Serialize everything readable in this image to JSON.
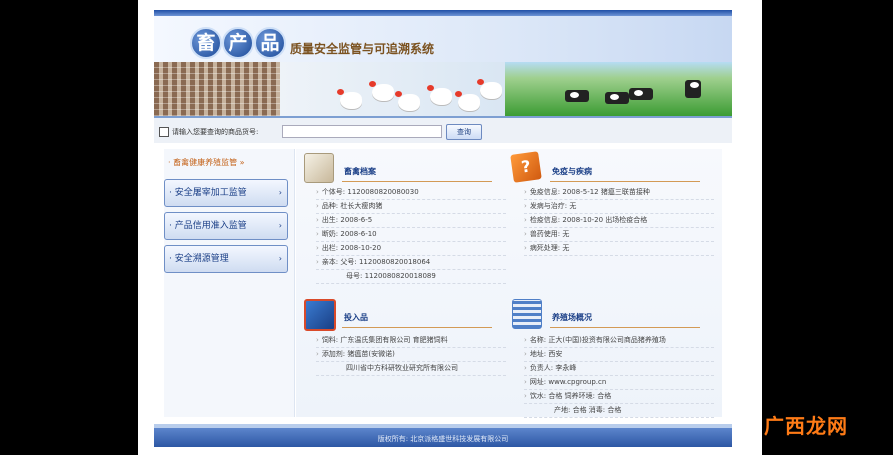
{
  "header": {
    "logo_chars": [
      "畜",
      "产",
      "品"
    ],
    "subtitle": "质量安全监管与可追溯系统"
  },
  "search": {
    "label": "请输入您要查询的商品货号:",
    "value": "",
    "button": "查询"
  },
  "sidebar": {
    "active": "· 畜禽健康养殖监管 »",
    "items": [
      {
        "label": "· 安全屠宰加工监管",
        "arrow": "›"
      },
      {
        "label": "· 产品信用准入监管",
        "arrow": "›"
      },
      {
        "label": "· 安全溯源管理",
        "arrow": "›"
      }
    ]
  },
  "panels": {
    "livestock": {
      "title": "畜禽档案",
      "rows": [
        "个体号: 1120080820080030",
        "品种: 杜长大瘦肉猪",
        "出生: 2008-6-5",
        "断奶: 2008-6-10",
        "出栏: 2008-10-20",
        "亲本: 父号: 1120080820018064",
        "母号: 1120080820018089"
      ]
    },
    "immunity": {
      "title": "免疫与疾病",
      "rows": [
        "免疫信息: 2008-5-12   猪瘟三联苗接种",
        "发病与治疗: 无",
        "检疫信息: 2008-10-20   出场检疫合格",
        "兽药使用: 无",
        "病死处理: 无"
      ]
    },
    "inputs": {
      "title": "投入品",
      "rows": [
        "饲料: 广东温氏集团有限公司 育肥猪饲料",
        "添加剂: 猪瘟苗(安微诺)",
        "四川省中方科研牧业研究所有限公司"
      ]
    },
    "farm": {
      "title": "养殖场概况",
      "rows": [
        "名称: 正大(中国)投资有限公司商品猪养殖场",
        "地址: 西安",
        "负责人: 李永峰",
        "网址: www.cpgroup.cn",
        "饮水: 合格        饲养环境: 合格",
        "产地: 合格        消毒: 合格"
      ]
    }
  },
  "footer": {
    "text": "版权所有: 北京派格盛世科技发展有限公司"
  },
  "watermark": "广西龙网"
}
